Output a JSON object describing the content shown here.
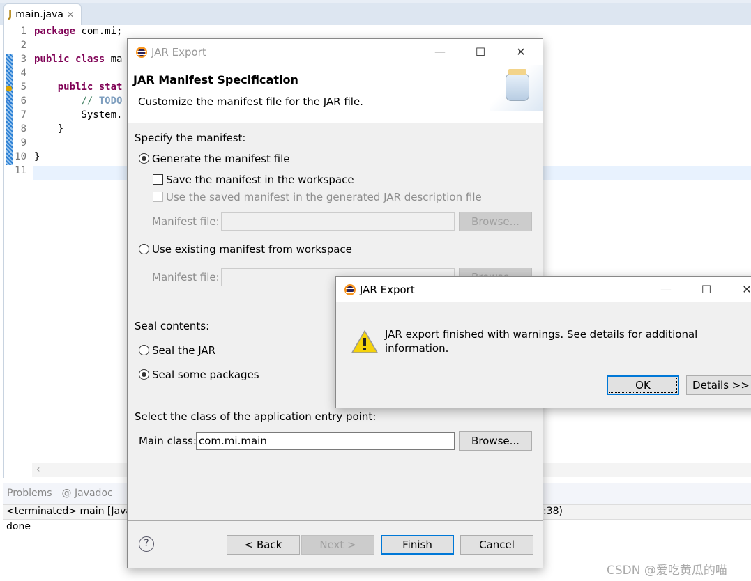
{
  "editor": {
    "tab_label": "main.java",
    "lines": [
      {
        "n": "1",
        "parts": [
          [
            "kw",
            "package"
          ],
          [
            "",
            "com.mi;"
          ]
        ]
      },
      {
        "n": "2",
        "parts": []
      },
      {
        "n": "3",
        "parts": [
          [
            "kw",
            "public class"
          ],
          [
            "",
            "ma"
          ]
        ]
      },
      {
        "n": "4",
        "parts": []
      },
      {
        "n": "5",
        "parts": [
          [
            "",
            "    "
          ],
          [
            "kw",
            "public stat"
          ]
        ]
      },
      {
        "n": "6",
        "parts": [
          [
            "",
            "        "
          ],
          [
            "cm",
            "// "
          ],
          [
            "todo",
            "TODO"
          ]
        ]
      },
      {
        "n": "7",
        "parts": [
          [
            "",
            "        System."
          ]
        ]
      },
      {
        "n": "8",
        "parts": [
          [
            "",
            "    }"
          ]
        ]
      },
      {
        "n": "9",
        "parts": []
      },
      {
        "n": "10",
        "parts": [
          [
            "",
            "}"
          ]
        ]
      },
      {
        "n": "11",
        "parts": []
      }
    ]
  },
  "console": {
    "tabs": [
      "Problems",
      "@ Javadoc"
    ],
    "header_left": "<terminated> main [Java",
    "header_right": ":38)",
    "output": "done"
  },
  "wizard": {
    "title": "JAR Export",
    "heading": "JAR Manifest Specification",
    "description": "Customize the manifest file for the JAR file.",
    "specify_label": "Specify the manifest:",
    "generate_label": "Generate the manifest file",
    "save_label": "Save the manifest in the workspace",
    "use_saved_label": "Use the saved manifest in the generated JAR description file",
    "manifest_file_label": "Manifest file:",
    "browse_label": "Browse...",
    "use_existing_label": "Use existing manifest from workspace",
    "seal_label": "Seal contents:",
    "seal_jar_label": "Seal the JAR",
    "seal_some_label": "Seal some packages",
    "entry_label": "Select the class of the application entry point:",
    "main_class_label": "Main class:",
    "main_class_value": "com.mi.main",
    "back_label": "< Back",
    "next_label": "Next >",
    "finish_label": "Finish",
    "cancel_label": "Cancel"
  },
  "alert": {
    "title": "JAR Export",
    "message": "JAR export finished with warnings. See details for additional information.",
    "ok_label": "OK",
    "details_label": "Details >>"
  },
  "watermark": "CSDN @爱吃黄瓜的喵"
}
